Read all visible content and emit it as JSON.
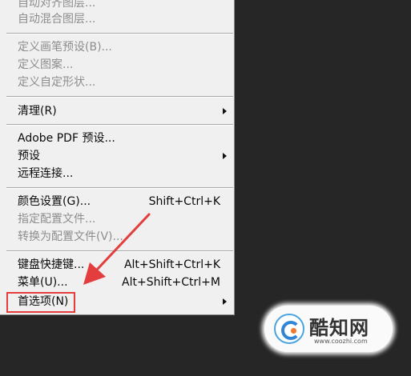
{
  "menu": {
    "items": [
      {
        "label": "自动对齐图层...",
        "shortcut": "",
        "disabled": true,
        "submenu": false
      },
      {
        "label": "自动混合图层...",
        "shortcut": "",
        "disabled": true,
        "submenu": false
      },
      {
        "label": "定义画笔预设(B)...",
        "shortcut": "",
        "disabled": true,
        "submenu": false
      },
      {
        "label": "定义图案...",
        "shortcut": "",
        "disabled": true,
        "submenu": false
      },
      {
        "label": "定义自定形状...",
        "shortcut": "",
        "disabled": true,
        "submenu": false
      },
      {
        "label": "清理(R)",
        "shortcut": "",
        "disabled": false,
        "submenu": true
      },
      {
        "label": "Adobe PDF 预设...",
        "shortcut": "",
        "disabled": false,
        "submenu": false
      },
      {
        "label": "预设",
        "shortcut": "",
        "disabled": false,
        "submenu": true
      },
      {
        "label": "远程连接...",
        "shortcut": "",
        "disabled": false,
        "submenu": false
      },
      {
        "label": "颜色设置(G)...",
        "shortcut": "Shift+Ctrl+K",
        "disabled": false,
        "submenu": false
      },
      {
        "label": "指定配置文件...",
        "shortcut": "",
        "disabled": true,
        "submenu": false
      },
      {
        "label": "转换为配置文件(V)...",
        "shortcut": "",
        "disabled": true,
        "submenu": false
      },
      {
        "label": "键盘快捷键...",
        "shortcut": "Alt+Shift+Ctrl+K",
        "disabled": false,
        "submenu": false
      },
      {
        "label": "菜单(U)...",
        "shortcut": "Alt+Shift+Ctrl+M",
        "disabled": false,
        "submenu": false
      },
      {
        "label": "首选项(N)",
        "shortcut": "",
        "disabled": false,
        "submenu": true
      }
    ]
  },
  "annotation": {
    "color": "#e43d3d",
    "highlighted_item": "首选项(N)"
  },
  "watermark": {
    "name": "酷知网",
    "url": "www.coozhi.com"
  }
}
